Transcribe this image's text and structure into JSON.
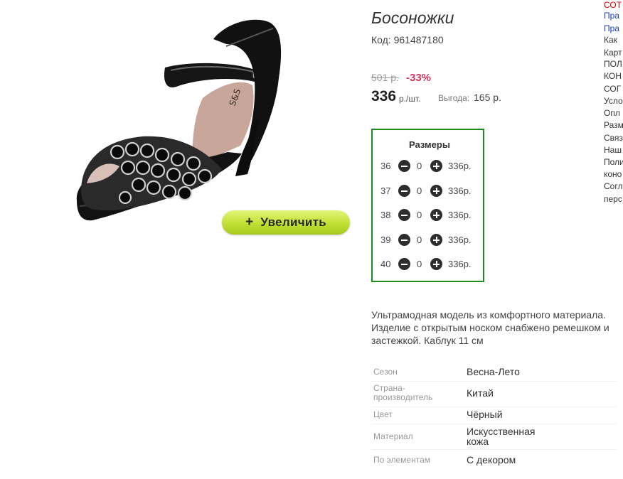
{
  "product": {
    "title": "Босоножки",
    "code": "Код: 961487180",
    "old_price": "501 р.",
    "discount": "-33%",
    "price": "336",
    "price_unit": "р./шт.",
    "savings_label": "Выгода:",
    "savings_value": "165 р.",
    "zoom_button": "Увеличить",
    "zoom_plus": "+",
    "description": "Ультрамодная модель из комфортного материала. Изделие с открытым носком снабжено ремешком и застежкой. Каблук 11 см"
  },
  "sizes": {
    "title": "Размеры",
    "rows": [
      {
        "size": "36",
        "qty": "0",
        "price": "336р."
      },
      {
        "size": "37",
        "qty": "0",
        "price": "336р."
      },
      {
        "size": "38",
        "qty": "0",
        "price": "336р."
      },
      {
        "size": "39",
        "qty": "0",
        "price": "336р."
      },
      {
        "size": "40",
        "qty": "0",
        "price": "336р."
      }
    ]
  },
  "specs": [
    {
      "label": "Сезон",
      "value": "Весна-Лето"
    },
    {
      "label": "Страна-производитель",
      "value": "Китай"
    },
    {
      "label": "Цвет",
      "value": "Чёрный"
    },
    {
      "label": "Материал",
      "value": "Искусственная кожа"
    },
    {
      "label": "По элементам",
      "value": "С декором"
    }
  ],
  "side_menu": [
    "СОТ",
    "Пра",
    "Пра",
    "Как",
    "Карт",
    "ПОЛ",
    "КОН",
    "СОГ",
    "Усло",
    "Опл",
    "Разм",
    "Связ",
    "Наш",
    "Поли",
    "коно",
    "Согл",
    "перс"
  ],
  "colors": {
    "sizes_border": "#1e8a1e",
    "discount": "#d9365e",
    "zoom_button": "#c2e034",
    "menu_red": "#d40000",
    "menu_link": "#1a3ccc"
  },
  "icons": {
    "minus": "minus-circle-icon",
    "plus": "plus-circle-icon",
    "zoom": "plus-icon"
  }
}
